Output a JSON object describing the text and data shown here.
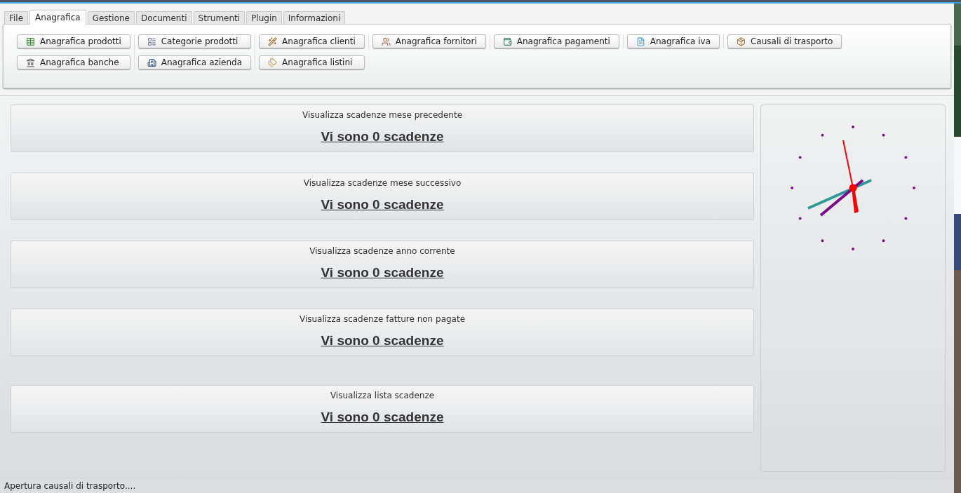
{
  "tabs": [
    {
      "label": "File",
      "selected": false
    },
    {
      "label": "Anagrafica",
      "selected": true
    },
    {
      "label": "Gestione",
      "selected": false
    },
    {
      "label": "Documenti",
      "selected": false
    },
    {
      "label": "Strumenti",
      "selected": false
    },
    {
      "label": "Plugin",
      "selected": false
    },
    {
      "label": "Informazioni",
      "selected": false
    }
  ],
  "ribbon_groups": [
    {
      "buttons": [
        "Anagrafica prodotti",
        "Anagrafica banche"
      ]
    },
    {
      "buttons": [
        "Categorie prodotti",
        "Anagrafica azienda"
      ]
    },
    {
      "buttons": [
        "Anagrafica clienti",
        "Anagrafica listini"
      ]
    },
    {
      "buttons": [
        "Anagrafica fornitori"
      ]
    },
    {
      "buttons": [
        "Anagrafica pagamenti"
      ]
    },
    {
      "buttons": [
        "Anagrafica iva"
      ]
    },
    {
      "buttons": [
        "Causali di trasporto"
      ]
    }
  ],
  "deadline_panels": [
    {
      "title": "Visualizza scadenze mese precedente",
      "link": "Vi sono 0 scadenze"
    },
    {
      "title": "Visualizza scadenze mese successivo",
      "link": "Vi sono 0 scadenze"
    },
    {
      "title": "Visualizza scadenze anno corrente",
      "link": "Vi sono 0 scadenze"
    },
    {
      "title": "Visualizza scadenze fatture non pagate",
      "link": "Vi sono 0 scadenze"
    },
    {
      "title": "Visualizza lista scadenze",
      "link": "Vi sono 0 scadenze"
    }
  ],
  "status_bar": "Apertura causali di trasporto...."
}
